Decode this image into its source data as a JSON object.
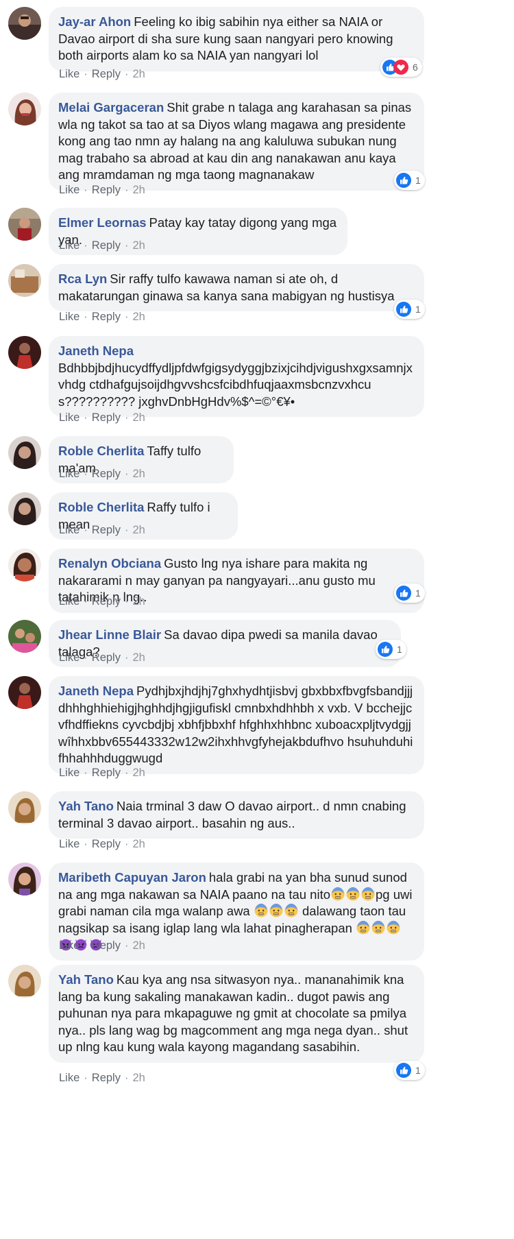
{
  "actions": {
    "like": "Like",
    "reply": "Reply",
    "separator": "·"
  },
  "colors": {
    "author": "#385898",
    "bubble": "#f2f3f5",
    "like_blue": "#1877f2",
    "love_red": "#f0284a",
    "angry_purple": "#7b2fbf"
  },
  "comments": [
    {
      "author": "Jay-ar Ahon",
      "text": "Feeling ko ibig sabihin nya either sa NAIA or Davao airport di sha sure kung saan nangyari pero knowing both airports alam ko sa NAIA yan nangyari lol",
      "time": "2h",
      "reactions": {
        "types": [
          "like-icon",
          "love-icon"
        ],
        "count": "6"
      }
    },
    {
      "author": "Melai Gargaceran",
      "text": "Shit grabe n talaga ang karahasan sa pinas wla ng takot sa tao at sa Diyos wlang magawa ang presidente kong ang tao nmn ay halang na ang kaluluwa subukan nung mag trabaho sa abroad at kau din ang nanakawan anu kaya ang mramdaman ng mga taong magnanakaw",
      "time": "2h",
      "reactions": {
        "types": [
          "like-icon"
        ],
        "count": "1"
      }
    },
    {
      "author": "Elmer Leornas",
      "text": "Patay kay tatay digong yang mga yan.",
      "time": "2h"
    },
    {
      "author": "Rca Lyn",
      "text": "Sir raffy tulfo kawawa naman si ate oh, d makatarungan ginawa sa kanya sana mabigyan ng hustisya",
      "time": "2h",
      "reactions": {
        "types": [
          "like-icon"
        ],
        "count": "1"
      }
    },
    {
      "author": "Janeth Nepa",
      "text": "Bdhbbjbdjhucydffydljpfdwfgigsydyggjbzixjcihdjvigushxgxsamnjxvhdg ctdhafgujsoijdhgvvshcsfcibdhfuqjaaxmsbcnzvxhcus?????????? jxghvDnbHgHdv%$^=©°€¥•",
      "time": "2h"
    },
    {
      "author": "Roble Cherlita",
      "text": "Taffy tulfo ma'am",
      "time": "2h"
    },
    {
      "author": "Roble Cherlita",
      "text": "Raffy tulfo i mean",
      "time": "2h"
    },
    {
      "author": "Renalyn Obciana",
      "text": "Gusto lng nya ishare para makita ng nakararami n may ganyan pa nangyayari...anu gusto mu tatahimik n lng..",
      "time": "2h",
      "reactions": {
        "types": [
          "like-icon"
        ],
        "count": "1"
      }
    },
    {
      "author": "Jhear Linne Blair",
      "text": "Sa davao dipa pwedi sa manila davao talaga?",
      "time": "2h",
      "reactions": {
        "types": [
          "like-icon"
        ],
        "count": "1"
      }
    },
    {
      "author": "Janeth Nepa",
      "text": "Pydhjbxjhdjhj7ghxhydhtjisbvj gbxbbxfbvgfsbandjjjdhhhghhiehigjhghhdjhgjigufiskl cmnbxhdhhbh x vxb. V bcchejjcvfhdffiekns cyvcbdjbj xbhfjbbxhf hfghhxhhbnc xuboacxpljtvydgjjwîhhxbbv655443332w12w2ihxhhvgfyhejakbdufhvo hsuhuhduhifhhahhhduggwugd",
      "time": "2h"
    },
    {
      "author": "Yah Tano",
      "text": "Naia trminal 3 daw O davao airport.. d nmn cnabing terminal 3 davao airport.. basahin ng aus..",
      "time": "2h"
    },
    {
      "author": "Maribeth Capuyan Jaron",
      "text_parts": [
        "hala grabi na yan bha sunud sunod na ang mga nakawan sa NAIA paano na tau nito",
        "pg uwi grabi naman cila mga walanp awa ",
        " dalawang taon tau nagsikap sa isang iglap lang wla lahat pinagherapan "
      ],
      "emoji_groups": [
        [
          "anxious-face-icon",
          "anxious-face-icon",
          "anxious-face-icon"
        ],
        [
          "anxious-face-icon",
          "anxious-face-icon",
          "anxious-face-icon"
        ],
        [
          "anxious-face-icon",
          "anxious-face-icon",
          "anxious-face-icon",
          "angry-devil-icon",
          "angry-devil-icon",
          "angry-devil-icon"
        ]
      ],
      "time": "2h"
    },
    {
      "author": "Yah Tano",
      "text": "Kau kya ang nsa sitwasyon nya.. mananahimik kna lang ba kung sakaling manakawan kadin.. dugot pawis ang puhunan nya para mkapaguwe ng gmit at chocolate sa pmilya nya.. pls lang wag bg magcomment ang mga nega dyan.. shut up nlng kau kung wala kayong magandang sasabihin.",
      "time": "2h",
      "reactions": {
        "types": [
          "like-icon"
        ],
        "count": "1"
      }
    }
  ]
}
